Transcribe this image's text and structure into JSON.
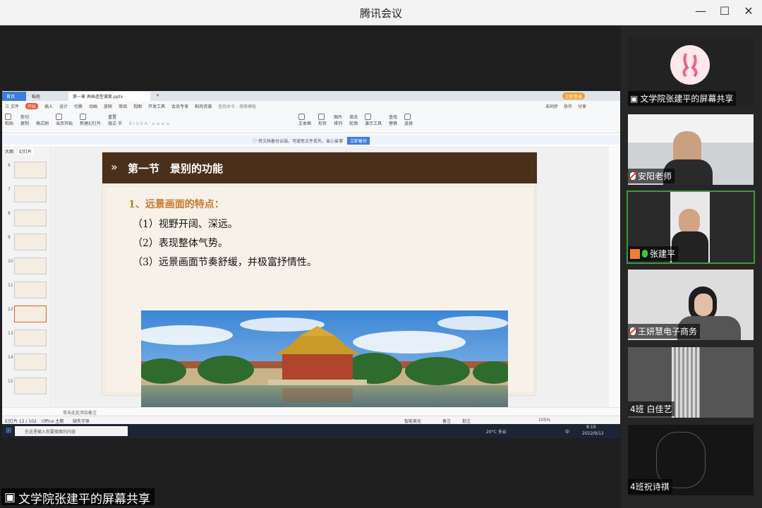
{
  "window": {
    "title": "腾讯会议"
  },
  "wps": {
    "tabs": [
      {
        "label": "首页"
      },
      {
        "label": "稻壳"
      },
      {
        "label": "第一章 再画造型课案.pptx"
      }
    ],
    "login": "立即登录",
    "menu": [
      "三 文件",
      "开始",
      "插入",
      "设计",
      "切换",
      "动画",
      "放映",
      "审阅",
      "视图",
      "开发工具",
      "会员专享",
      "稻壳资源"
    ],
    "search_placeholder": "查找命令、搜索模板",
    "right_menu": [
      "未同步",
      "协作",
      "分享"
    ],
    "ribbon": [
      "粘贴",
      "剪切",
      "复制",
      "格式刷",
      "当页开始",
      "新建幻灯片",
      "版式",
      "节",
      "重置",
      "文本框",
      "形状",
      "排列",
      "演示工具",
      "查找",
      "替换",
      "选择",
      "图片",
      "填充",
      "轮廓"
    ],
    "notice": "将文档备份云端，可避免文件丢失，省心省事",
    "notice_button": "立即备份",
    "side_tabs": [
      "大纲",
      "幻灯片"
    ],
    "thumb_numbers": [
      "6",
      "7",
      "8",
      "9",
      "10",
      "11",
      "12",
      "13",
      "14",
      "15"
    ],
    "status": {
      "slide": "幻灯片 12 / 102",
      "theme": "Office 主题",
      "font": "缺失字体",
      "smart": "智能美化",
      "notes": "备注",
      "comment": "批注",
      "zoom": "105%",
      "notes_hint": "单击此处添加备注"
    }
  },
  "slide": {
    "heading": "第一节　景别的功能",
    "lines": [
      "1、远景画面的特点：",
      "（1）视野开阔、深远。",
      "（2）表现整体气势。",
      "（3）远景画面节奏舒缓，并极富抒情性。"
    ]
  },
  "taskbar": {
    "search": "在这里输入你要搜索的内容",
    "weather": "20°C 多云",
    "time": "8:19",
    "date": "2022/9/12",
    "ime": "中"
  },
  "participants": [
    {
      "name": "文学院张建平的屏幕共享"
    },
    {
      "name": "安阳老师"
    },
    {
      "name": "张建平"
    },
    {
      "name": "王妍慧电子商务"
    },
    {
      "name": "4班  白佳艺"
    },
    {
      "name": "4班祝诗祺"
    }
  ],
  "share_badge": "文学院张建平的屏幕共享",
  "colors": {
    "slide_header": "#4a2f1a",
    "accent": "#c9782b",
    "active_speaker": "#3c9a3c"
  }
}
